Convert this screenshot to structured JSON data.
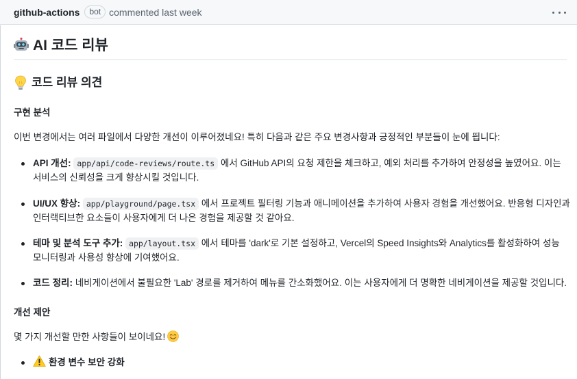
{
  "header": {
    "author": "github-actions",
    "badge": "bot",
    "meta": "commented last week"
  },
  "content": {
    "title": "AI 코드 리뷰",
    "section_title": "코드 리뷰 의견",
    "analysis_heading": "구현 분석",
    "intro": "이번 변경에서는 여러 파일에서 다양한 개선이 이루어졌네요! 특히 다음과 같은 주요 변경사항과 긍정적인 부분들이 눈에 띕니다:",
    "items": [
      {
        "label": "API 개선",
        "code": "app/api/code-reviews/route.ts",
        "line1_rest": "에서 GitHub API의 요청 제한을 체크하고, 예외 처리를 추가하여 안정성을 높였어요. 이는",
        "line2": "서비스의 신뢰성을 크게 향상시킬 것입니다."
      },
      {
        "label": "UI/UX 향상",
        "code": "app/playground/page.tsx",
        "line1_rest": "에서 프로젝트 필터링 기능과 애니메이션을 추가하여 사용자 경험을 개선했어요. 반응형 디자인과",
        "line2": "인터랙티브한 요소들이 사용자에게 더 나은 경험을 제공할 것 같아요."
      },
      {
        "label": "테마 및 분석 도구 추가",
        "code": "app/layout.tsx",
        "line1_rest": "에서 테마를 'dark'로 기본 설정하고, Vercel의 Speed Insights와 Analytics를 활성화하여 성능",
        "line2": "모니터링과 사용성 향상에 기여했어요."
      },
      {
        "label": "코드 정리",
        "line1_rest": "네비게이션에서 불필요한 'Lab' 경로를 제거하여 메뉴를 간소화했어요. 이는 사용자에게 더 명확한 네비게이션을 제공할 것입니다."
      }
    ],
    "suggest_heading": "개선 제안",
    "suggest_intro": "몇 가지 개선할 만한 사항들이 보이네요!",
    "suggest_item": "환경 변수 보안 강화"
  }
}
